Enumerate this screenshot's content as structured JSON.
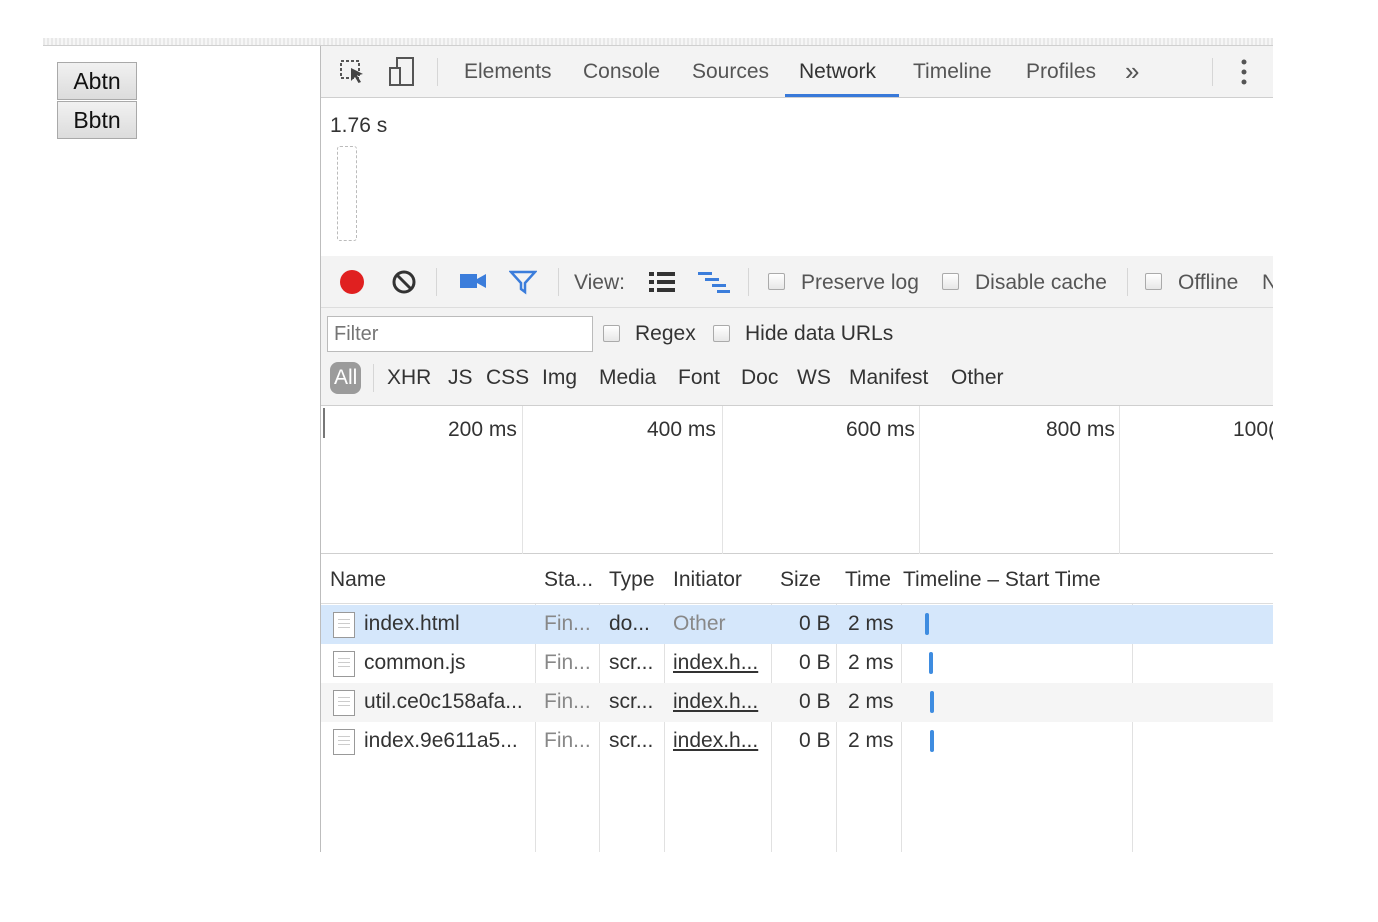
{
  "page": {
    "buttons": [
      "Abtn",
      "Bbtn"
    ]
  },
  "devtools": {
    "tabs": [
      "Elements",
      "Console",
      "Sources",
      "Network",
      "Timeline",
      "Profiles"
    ],
    "active_tab": "Network",
    "more_tabs_label": "»",
    "accent_color": "#3879d9",
    "overview": {
      "load_time": "1.76 s"
    },
    "toolbar": {
      "view_label": "View:",
      "preserve_log_label": "Preserve log",
      "disable_cache_label": "Disable cache",
      "offline_label": "Offline",
      "truncated_label": "N",
      "record_color": "#e02020",
      "icon_color": "#3b7ddb"
    },
    "filter": {
      "placeholder": "Filter",
      "regex_label": "Regex",
      "hide_data_urls_label": "Hide data URLs",
      "types": [
        "All",
        "XHR",
        "JS",
        "CSS",
        "Img",
        "Media",
        "Font",
        "Doc",
        "WS",
        "Manifest",
        "Other"
      ],
      "active_type": "All"
    },
    "timeline_ticks": [
      "200 ms",
      "400 ms",
      "600 ms",
      "800 ms",
      "100("
    ],
    "table": {
      "columns": [
        "Name",
        "Sta...",
        "Type",
        "Initiator",
        "Size",
        "Time",
        "Timeline – Start Time"
      ],
      "rows": [
        {
          "name": "index.html",
          "status": "Fin...",
          "type": "do...",
          "initiator": "Other",
          "size": "0 B",
          "time": "2 ms"
        },
        {
          "name": "common.js",
          "status": "Fin...",
          "type": "scr...",
          "initiator": "index.h...",
          "size": "0 B",
          "time": "2 ms"
        },
        {
          "name": "util.ce0c158afa...",
          "status": "Fin...",
          "type": "scr...",
          "initiator": "index.h...",
          "size": "0 B",
          "time": "2 ms"
        },
        {
          "name": "index.9e611a5...",
          "status": "Fin...",
          "type": "scr...",
          "initiator": "index.h...",
          "size": "0 B",
          "time": "2 ms"
        }
      ]
    }
  }
}
